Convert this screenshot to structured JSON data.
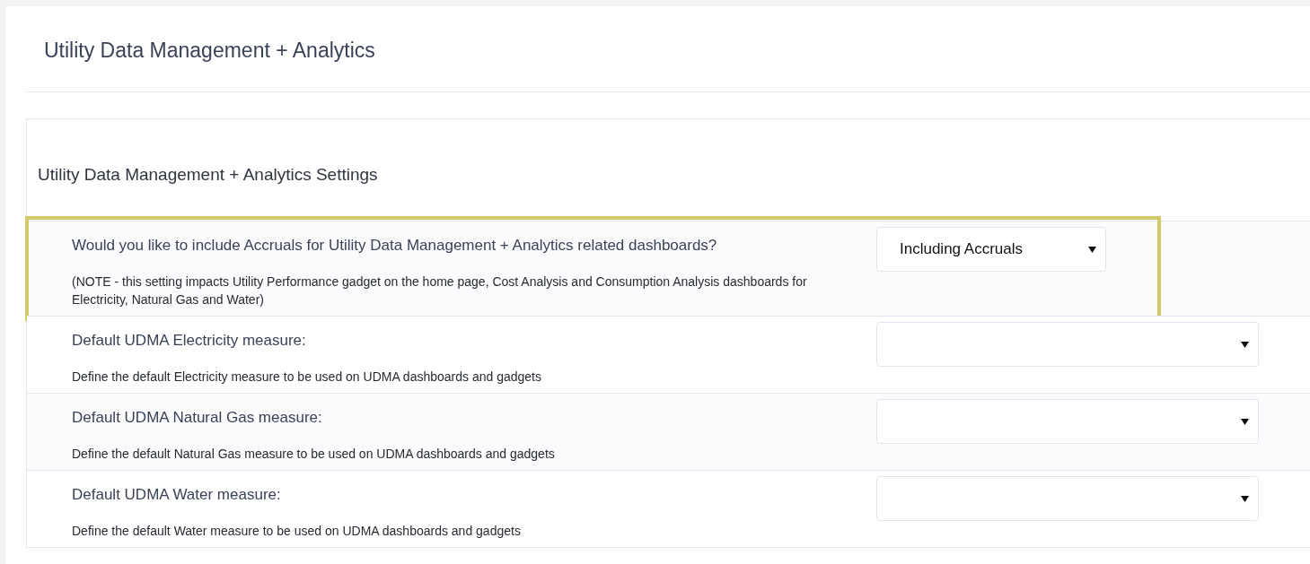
{
  "page": {
    "title": "Utility Data Management + Analytics"
  },
  "settings": {
    "heading": "Utility Data Management + Analytics Settings",
    "rows": [
      {
        "kind": "short-select",
        "highlighted": true,
        "label": "Would you like to include Accruals for Utility Data Management + Analytics related dashboards?",
        "description": "(NOTE - this setting impacts Utility Performance gadget on the home page, Cost Analysis and Consumption Analysis dashboards for Electricity, Natural Gas and Water)",
        "value": "Including Accruals"
      },
      {
        "kind": "select",
        "highlighted": false,
        "label": "Default UDMA Electricity measure:",
        "description": "Define the default Electricity measure to be used on UDMA dashboards and gadgets"
      },
      {
        "kind": "select",
        "highlighted": false,
        "label": "Default UDMA Natural Gas measure:",
        "description": "Define the default Natural Gas measure to be used on UDMA dashboards and gadgets"
      },
      {
        "kind": "select",
        "highlighted": false,
        "label": "Default UDMA Water measure:",
        "description": "Define the default Water measure to be used on UDMA dashboards and gadgets"
      }
    ]
  }
}
